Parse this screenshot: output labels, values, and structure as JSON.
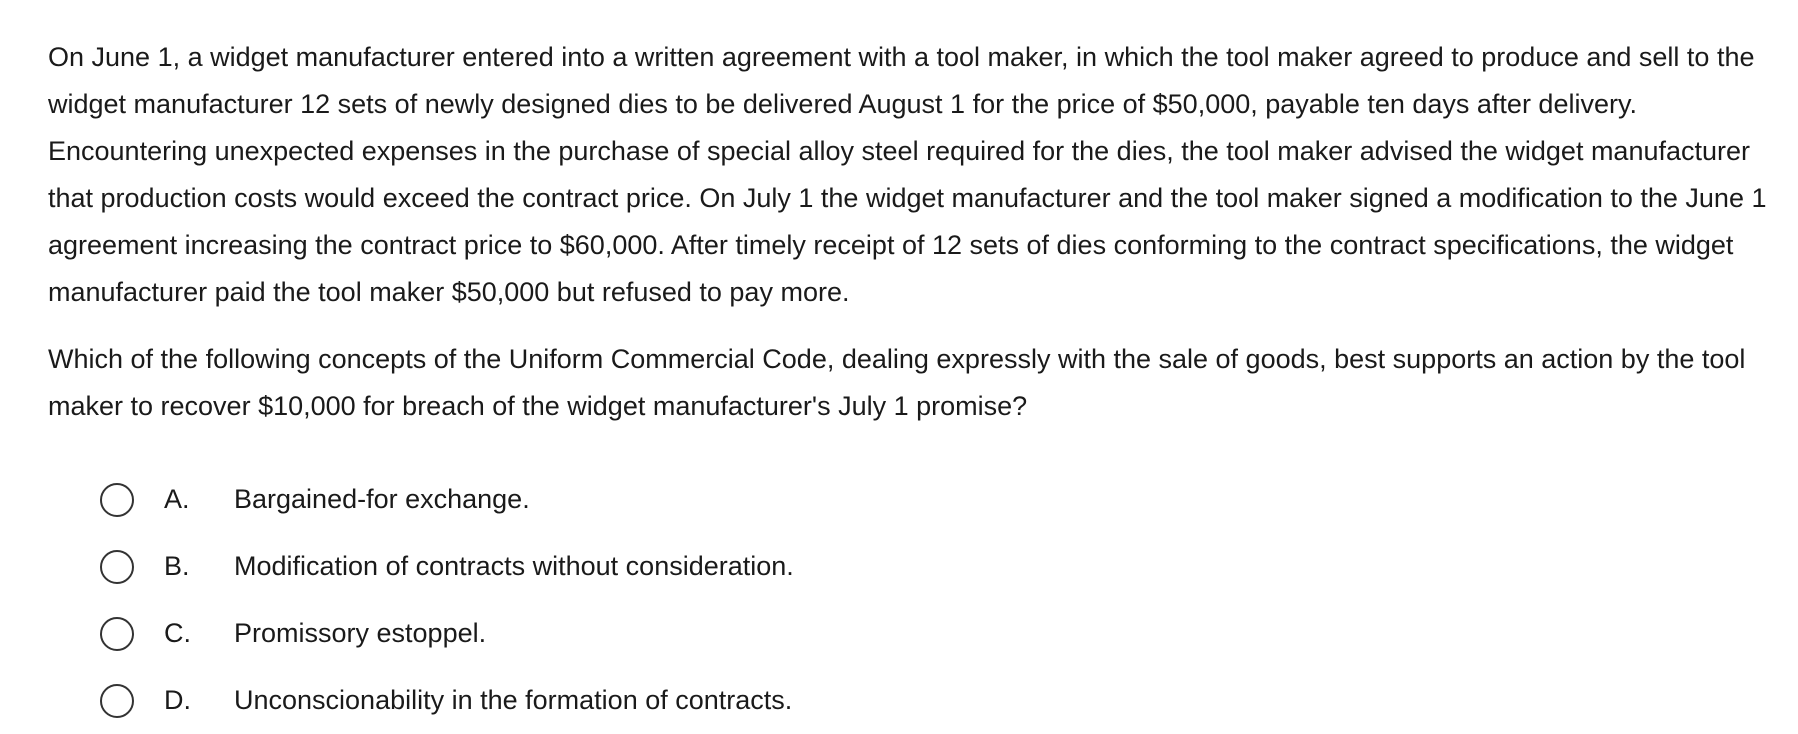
{
  "question": {
    "stem": "On June 1, a widget manufacturer entered into a written agreement with a tool maker, in which the tool maker agreed to produce and sell to the widget manufacturer 12 sets of newly designed dies to be delivered August 1 for the price of $50,000, payable ten days after delivery.  Encountering unexpected expenses in the purchase of special alloy steel required for the dies, the tool maker advised the widget manufacturer that production costs would exceed the contract price.  On July 1 the widget manufacturer and the tool maker signed a modification to the June 1 agreement increasing the contract price to $60,000.  After timely receipt of 12 sets of dies conforming to the contract specifications, the widget manufacturer paid the tool maker $50,000 but refused to pay more.",
    "prompt": "Which of the following concepts of the Uniform Commercial Code, dealing expressly with the sale of goods, best supports an action by the tool maker to recover $10,000 for breach of the widget manufacturer's July 1 promise?",
    "options": [
      {
        "letter": "A.",
        "text": "Bargained-for exchange."
      },
      {
        "letter": "B.",
        "text": "Modification of contracts without consideration."
      },
      {
        "letter": "C.",
        "text": "Promissory estoppel."
      },
      {
        "letter": "D.",
        "text": "Unconscionability in the formation of contracts."
      }
    ]
  }
}
